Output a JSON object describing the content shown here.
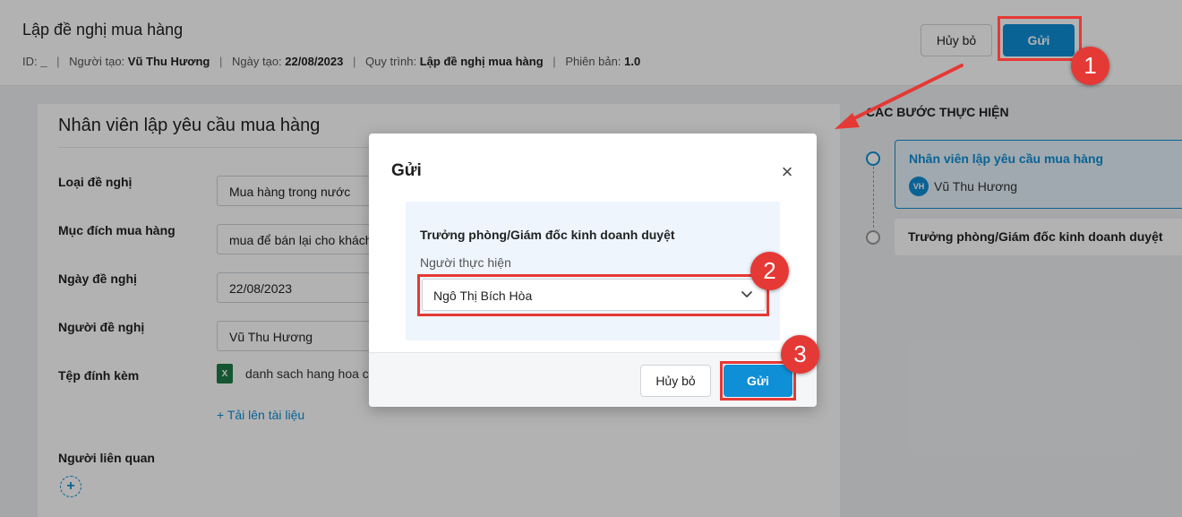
{
  "header": {
    "title": "Lập đề nghị mua hàng",
    "meta": {
      "id_label": "ID:",
      "id_value": "_",
      "creator_label": "Người tạo:",
      "creator_value": "Vũ Thu Hương",
      "created_label": "Ngày tạo:",
      "created_value": "22/08/2023",
      "process_label": "Quy trình:",
      "process_value": "Lập đề nghị mua hàng",
      "version_label": "Phiên bản:",
      "version_value": "1.0",
      "separator": "|"
    },
    "cancel_label": "Hủy bỏ",
    "send_label": "Gửi"
  },
  "form": {
    "title": "Nhân viên lập yêu cầu mua hàng",
    "fields": [
      {
        "label": "Loại đề nghị",
        "value": "Mua hàng trong nước"
      },
      {
        "label": "Mục đích mua hàng",
        "value": "mua để bán lại cho khách"
      },
      {
        "label": "Ngày đề nghị",
        "value": "22/08/2023"
      },
      {
        "label": "Người đề nghị",
        "value": "Vũ Thu Hương"
      }
    ],
    "attachment_label": "Tệp đính kèm",
    "attachment_file": "danh sach hang hoa ca",
    "attachment_icon_text": "X",
    "upload_label": "+ Tải lên tài liệu",
    "related_label": "Người liên quan",
    "add_symbol": "+"
  },
  "steps": {
    "title": "CÁC BƯỚC THỰC HIỆN",
    "items": [
      {
        "name": "Nhân viên lập yêu cầu mua hàng",
        "avatar": "VH",
        "person": "Vũ Thu Hương"
      },
      {
        "name": "Trưởng phòng/Giám đốc kinh doanh duyệt"
      }
    ]
  },
  "modal": {
    "title": "Gửi",
    "close_symbol": "×",
    "step_heading": "Trưởng phòng/Giám đốc kinh doanh duyệt",
    "performer_label": "Người thực hiện",
    "performer_value": "Ngô Thị Bích Hòa",
    "cancel_label": "Hủy bỏ",
    "send_label": "Gửi"
  },
  "markers": [
    "1",
    "2",
    "3"
  ],
  "colors": {
    "primary": "#0e8fd6",
    "highlight": "#e53935",
    "excel": "#1e7c45"
  }
}
